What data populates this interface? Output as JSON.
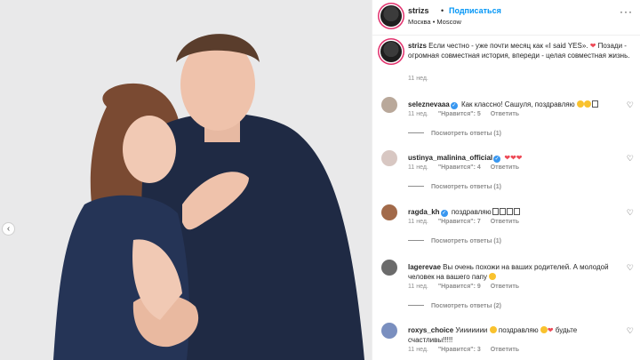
{
  "header": {
    "username": "strizs",
    "dot": "•",
    "follow_label": "Подписаться",
    "location": "Москва • Moscow",
    "more": "···"
  },
  "caption": {
    "username": "strizs",
    "text_before_heart": "Если честно - уже почти месяц как «I said YES».",
    "heart": "❤",
    "text_after_heart": " Позади - огромная совместная история, впереди - целая совместная жизнь.",
    "time": "11 нед."
  },
  "comments": [
    {
      "username": "seleznevaaa",
      "verified": true,
      "text": "Как классно! Сашуля, поздравляю",
      "emojis": "face,face,face",
      "time": "11 нед.",
      "likes": "\"Нравится\": 5",
      "reply": "Ответить",
      "view_replies": "Посмотреть ответы (1)"
    },
    {
      "username": "ustinya_malinina_official",
      "verified": true,
      "text": "",
      "hearts": "❤❤❤",
      "time": "11 нед.",
      "likes": "\"Нравится\": 4",
      "reply": "Ответить",
      "view_replies": "Посмотреть ответы (1)"
    },
    {
      "username": "ragda_kh",
      "verified": true,
      "text": "поздравляю",
      "time": "11 нед.",
      "likes": "\"Нравится\": 7",
      "reply": "Ответить",
      "view_replies": "Посмотреть ответы (1)"
    },
    {
      "username": "lagerevae",
      "verified": false,
      "text": "Вы очень похожи на ваших родителей. А молодой человек на вашего папу",
      "time": "11 нед.",
      "likes": "\"Нравится\": 9",
      "reply": "Ответить",
      "view_replies": "Посмотреть ответы (2)"
    },
    {
      "username": "roxys_choice",
      "verified": false,
      "text_a": "Уиииииии",
      "text_b": "поздравляю",
      "text_c": "будьте счастливы!!!!!",
      "time": "11 нед.",
      "likes": "\"Нравится\": 3",
      "reply": "Ответить"
    }
  ],
  "colors": {
    "accent": "#0095f6",
    "heart": "#ed4956",
    "muted": "#8e8e8e",
    "photo_bg": "#e9e9ea"
  },
  "icons": {
    "prev": "‹",
    "heart_outline": "♡",
    "verified": "✓"
  }
}
